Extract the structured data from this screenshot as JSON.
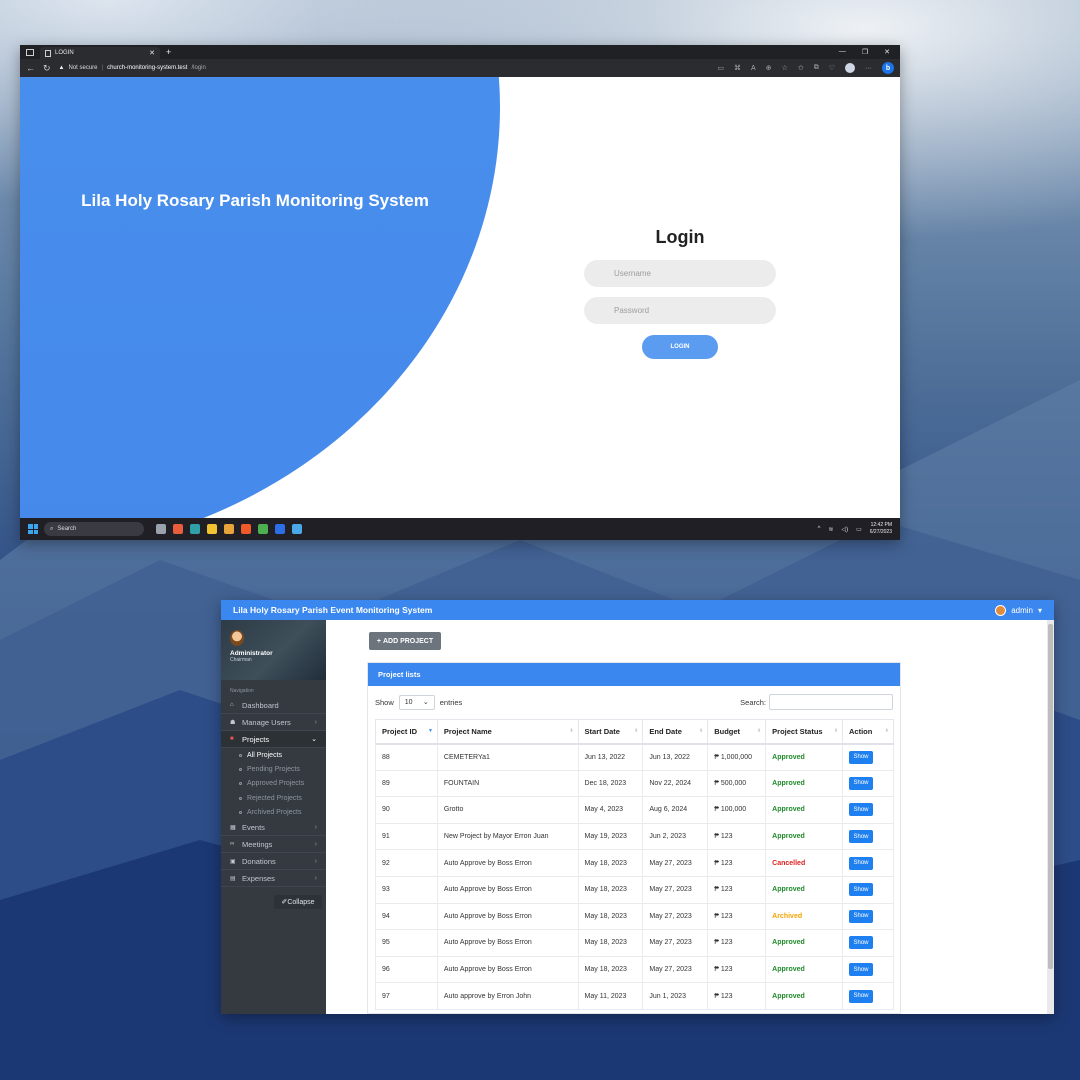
{
  "browser": {
    "tab_title": "LOGIN",
    "new_tab": "+",
    "security": "Not secure",
    "url_host": "church-monitoring-system.test",
    "url_path": "/login"
  },
  "login": {
    "brand_title": "Lila Holy Rosary Parish Monitoring System",
    "heading": "Login",
    "username_placeholder": "Username",
    "password_placeholder": "Password",
    "button": "LOGIN"
  },
  "taskbar": {
    "search": "Search",
    "time": "12:42 PM",
    "date": "6/27/2023"
  },
  "admin": {
    "title": "Lila Holy Rosary Parish Event Monitoring System",
    "user": "admin",
    "profile_role": "Administrator",
    "profile_sub": "Chairman",
    "nav_label": "Navigation",
    "nav": {
      "dashboard": "Dashboard",
      "manage_users": "Manage Users",
      "projects": "Projects",
      "events": "Events",
      "meetings": "Meetings",
      "donations": "Donations",
      "expenses": "Expenses"
    },
    "sub_nav": {
      "all": "All Projects",
      "pending": "Pending Projects",
      "approved": "Approved Projects",
      "rejected": "Rejected Projects",
      "archived": "Archived Projects"
    },
    "collapse": "Collapse",
    "add_project": "ADD PROJECT",
    "card_title": "Project lists",
    "show_label": "Show",
    "entries_value": "10",
    "entries_label": "entries",
    "search_label": "Search:",
    "columns": [
      "Project ID",
      "Project Name",
      "Start Date",
      "End Date",
      "Budget",
      "Project Status",
      "Action"
    ],
    "rows": [
      {
        "id": "88",
        "name": "CEMETERYa1",
        "start": "Jun 13, 2022",
        "end": "Jun 13, 2022",
        "budget": "₱ 1,000,000",
        "status": "Approved",
        "action": "Show"
      },
      {
        "id": "89",
        "name": "FOUNTAIN",
        "start": "Dec 18, 2023",
        "end": "Nov 22, 2024",
        "budget": "₱ 500,000",
        "status": "Approved",
        "action": "Show"
      },
      {
        "id": "90",
        "name": "Grotto",
        "start": "May 4, 2023",
        "end": "Aug 6, 2024",
        "budget": "₱ 100,000",
        "status": "Approved",
        "action": "Show"
      },
      {
        "id": "91",
        "name": "New Project by Mayor Erron Juan",
        "start": "May 19, 2023",
        "end": "Jun 2, 2023",
        "budget": "₱ 123",
        "status": "Approved",
        "action": "Show"
      },
      {
        "id": "92",
        "name": "Auto Approve by Boss Erron",
        "start": "May 18, 2023",
        "end": "May 27, 2023",
        "budget": "₱ 123",
        "status": "Cancelled",
        "action": "Show"
      },
      {
        "id": "93",
        "name": "Auto Approve by Boss Erron",
        "start": "May 18, 2023",
        "end": "May 27, 2023",
        "budget": "₱ 123",
        "status": "Approved",
        "action": "Show"
      },
      {
        "id": "94",
        "name": "Auto Approve by Boss Erron",
        "start": "May 18, 2023",
        "end": "May 27, 2023",
        "budget": "₱ 123",
        "status": "Archived",
        "action": "Show"
      },
      {
        "id": "95",
        "name": "Auto Approve by Boss Erron",
        "start": "May 18, 2023",
        "end": "May 27, 2023",
        "budget": "₱ 123",
        "status": "Approved",
        "action": "Show"
      },
      {
        "id": "96",
        "name": "Auto Approve by Boss Erron",
        "start": "May 18, 2023",
        "end": "May 27, 2023",
        "budget": "₱ 123",
        "status": "Approved",
        "action": "Show"
      },
      {
        "id": "97",
        "name": "Auto approve by Erron John",
        "start": "May 11, 2023",
        "end": "Jun 1, 2023",
        "budget": "₱ 123",
        "status": "Approved",
        "action": "Show"
      }
    ]
  },
  "colors": {
    "primary_blue": "#3a87f0",
    "login_blue": "#4589eb",
    "approved": "#1f8a2a",
    "cancelled": "#dc2020",
    "archived": "#f0a500",
    "sidebar": "#343a40"
  }
}
